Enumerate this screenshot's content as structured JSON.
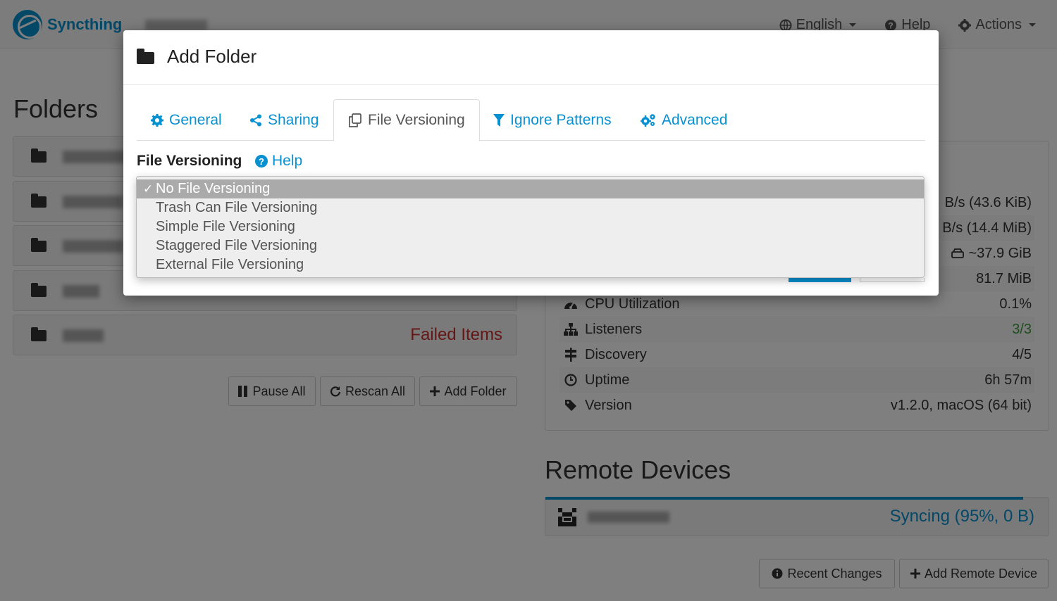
{
  "app": {
    "brand": "Syncthing",
    "nav": {
      "language": "English",
      "help": "Help",
      "actions": "Actions"
    }
  },
  "folders": {
    "title": "Folders",
    "failed_items": "Failed Items",
    "buttons": {
      "pause_all": "Pause All",
      "rescan_all": "Rescan All",
      "add_folder": "Add Folder"
    }
  },
  "this_device": {
    "stats": [
      {
        "label": "",
        "value": "B/s (43.6 KiB)",
        "icon": "download-icon"
      },
      {
        "label": "",
        "value": "B/s (14.4 MiB)",
        "icon": "upload-icon"
      },
      {
        "label": "",
        "value": "~37.9 GiB",
        "icon": "hdd-icon"
      },
      {
        "label": "",
        "value": "81.7 MiB",
        "icon": "memory-icon"
      },
      {
        "label": "CPU Utilization",
        "value": "0.1%",
        "icon": "dashboard-icon"
      },
      {
        "label": "Listeners",
        "value": "3/3",
        "icon": "sitemap-icon"
      },
      {
        "label": "Discovery",
        "value": "4/5",
        "icon": "signpost-icon"
      },
      {
        "label": "Uptime",
        "value": "6h 57m",
        "icon": "clock-icon"
      },
      {
        "label": "Version",
        "value": "v1.2.0, macOS (64 bit)",
        "icon": "tag-icon"
      }
    ]
  },
  "remote_devices": {
    "title": "Remote Devices",
    "device_status": "Syncing (95%, 0 B)",
    "sync_progress": 0.95,
    "buttons": {
      "recent_changes": "Recent Changes",
      "add_remote_device": "Add Remote Device"
    }
  },
  "modal": {
    "title": "Add Folder",
    "tabs": [
      {
        "label": "General",
        "icon": "gear-icon"
      },
      {
        "label": "Sharing",
        "icon": "share-icon"
      },
      {
        "label": "File Versioning",
        "icon": "copy-icon",
        "active": true
      },
      {
        "label": "Ignore Patterns",
        "icon": "filter-icon"
      },
      {
        "label": "Advanced",
        "icon": "gears-icon"
      }
    ],
    "file_versioning_label": "File Versioning",
    "help_label": "Help",
    "dropdown": {
      "selected": "No File Versioning",
      "options": [
        "No File Versioning",
        "Trash Can File Versioning",
        "Simple File Versioning",
        "Staggered File Versioning",
        "External File Versioning"
      ]
    }
  },
  "colors": {
    "accent": "#0891d1",
    "danger": "#c9302c",
    "success": "#3c9b3c"
  }
}
